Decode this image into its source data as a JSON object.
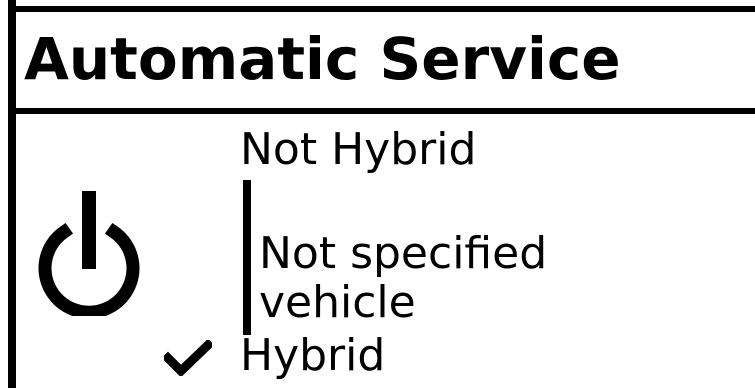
{
  "screen": {
    "title": "Automatic Service",
    "status_icon": "power-icon"
  },
  "menu": {
    "options": [
      {
        "label": "Not Hybrid",
        "selected": false,
        "checked": false
      },
      {
        "label_line_1": "Not specified",
        "label_line_2": "vehicle",
        "selected": true,
        "checked": false
      },
      {
        "label": "Hybrid",
        "selected": false,
        "checked": true,
        "check_icon": "check-icon"
      }
    ]
  },
  "colors": {
    "foreground": "#000000",
    "background": "#ffffff"
  }
}
